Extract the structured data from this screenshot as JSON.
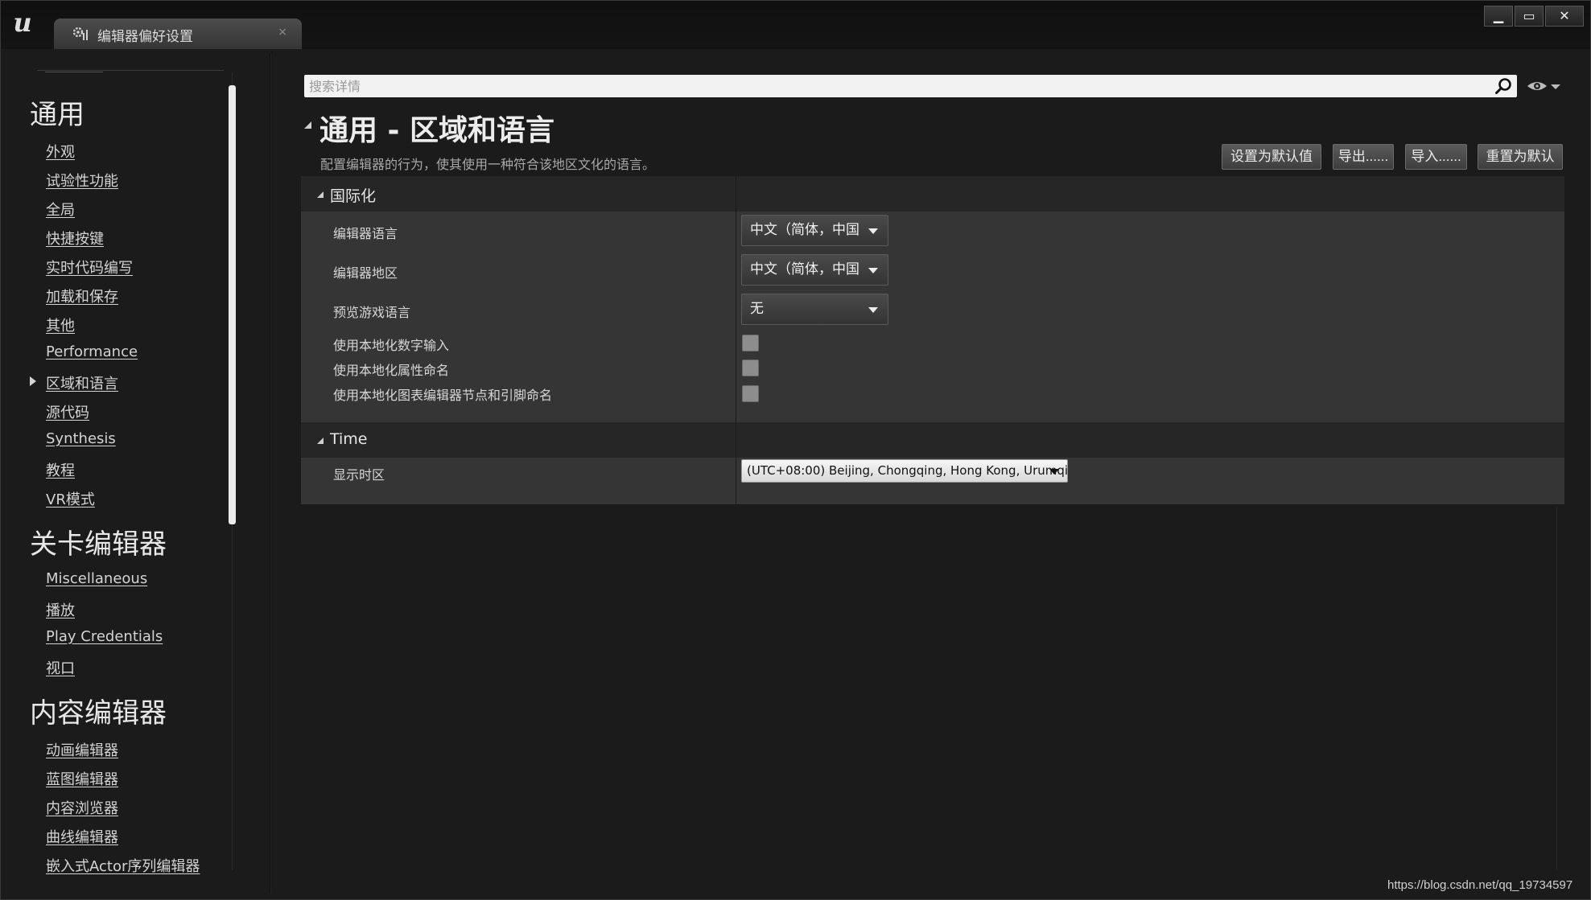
{
  "window": {
    "tab_title": "编辑器偏好设置",
    "tab_close": "×",
    "minimize": "▁",
    "maximize": "▭",
    "close": "✕"
  },
  "nav": {
    "sections": [
      {
        "title": "通用",
        "items": [
          "外观",
          "试验性功能",
          "全局",
          "快捷按键",
          "实时代码编写",
          "加载和保存",
          "其他",
          "Performance",
          "区域和语言",
          "源代码",
          "Synthesis",
          "教程",
          "VR模式"
        ]
      },
      {
        "title": "关卡编辑器",
        "items": [
          "Miscellaneous",
          "播放",
          "Play Credentials",
          "视口"
        ]
      },
      {
        "title": "内容编辑器",
        "items": [
          "动画编辑器",
          "蓝图编辑器",
          "内容浏览器",
          "曲线编辑器",
          "嵌入式Actor序列编辑器"
        ]
      }
    ],
    "active_item": "区域和语言"
  },
  "search": {
    "placeholder": "搜索详情"
  },
  "page": {
    "title": "通用 - 区域和语言",
    "description": "配置编辑器的行为，使其使用一种符合该地区文化的语言。"
  },
  "actions": {
    "set_default": "设置为默认值",
    "export": "导出......",
    "import": "导入......",
    "reset_default": "重置为默认"
  },
  "internationalization": {
    "header": "国际化",
    "editor_language_label": "编辑器语言",
    "editor_language_value": "中文（简体，中国",
    "editor_region_label": "编辑器地区",
    "editor_region_value": "中文（简体，中国",
    "preview_game_language_label": "预览游戏语言",
    "preview_game_language_value": "无",
    "localized_numeric_input_label": "使用本地化数字输入",
    "localized_numeric_input": false,
    "localized_property_names_label": "使用本地化属性命名",
    "localized_property_names": false,
    "localized_graph_names_label": "使用本地化图表编辑器节点和引脚命名",
    "localized_graph_names": false
  },
  "time": {
    "header": "Time",
    "display_timezone_label": "显示时区",
    "display_timezone_value": "(UTC+08:00) Beijing, Chongqing, Hong Kong, Urumqi"
  },
  "watermark": "https://blog.csdn.net/qq_19734597",
  "colors": {
    "background": "#1b1b1b",
    "panel": "#353535",
    "panel_header": "#262626",
    "text": "#d6d6d6"
  }
}
